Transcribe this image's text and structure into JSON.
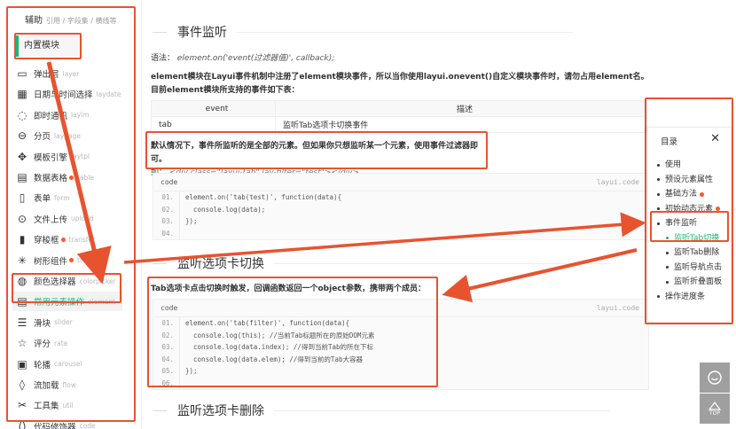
{
  "sidebar": {
    "head_title": "辅助",
    "head_sub": "引用 / 字段集 / 横线等",
    "group_label": "内置模块",
    "items": [
      {
        "icon": "layer-icon",
        "glyph": "▭",
        "label": "弹出层",
        "en": "layer",
        "dot": false
      },
      {
        "icon": "calendar-icon",
        "glyph": "▦",
        "label": "日期与时间选择",
        "en": "laydate",
        "dot": false
      },
      {
        "icon": "chat-icon",
        "glyph": "◌",
        "label": "即时通讯",
        "en": "layim",
        "dot": false
      },
      {
        "icon": "page-icon",
        "glyph": "⊖",
        "label": "分页",
        "en": "laypage",
        "dot": false
      },
      {
        "icon": "template-icon",
        "glyph": "✥",
        "label": "模板引擎",
        "en": "laytpl",
        "dot": false
      },
      {
        "icon": "table-icon",
        "glyph": "▤",
        "label": "数据表格",
        "en": "table",
        "dot": true
      },
      {
        "icon": "form-icon",
        "glyph": "▯",
        "label": "表单",
        "en": "form",
        "dot": false
      },
      {
        "icon": "upload-icon",
        "glyph": "⊙",
        "label": "文件上传",
        "en": "upload",
        "dot": false
      },
      {
        "icon": "transfer-icon",
        "glyph": "▮",
        "label": "穿梭框",
        "en": "transfer",
        "dot": true
      },
      {
        "icon": "tree-icon",
        "glyph": "✳",
        "label": "树形组件",
        "en": "tree",
        "dot": true
      },
      {
        "icon": "palette-icon",
        "glyph": "◍",
        "label": "颜色选择器",
        "en": "colorpicker",
        "dot": false
      },
      {
        "icon": "element-icon",
        "glyph": "▤",
        "label": "常用元素操作",
        "en": "element",
        "dot": false
      },
      {
        "icon": "slider-icon",
        "glyph": "☰",
        "label": "滑块",
        "en": "slider",
        "dot": false
      },
      {
        "icon": "star-icon",
        "glyph": "☆",
        "label": "评分",
        "en": "rate",
        "dot": false
      },
      {
        "icon": "carousel-icon",
        "glyph": "▣",
        "label": "轮播",
        "en": "carousel",
        "dot": false
      },
      {
        "icon": "flow-icon",
        "glyph": "◊",
        "label": "流加载",
        "en": "flow",
        "dot": false
      },
      {
        "icon": "tools-icon",
        "glyph": "✂",
        "label": "工具集",
        "en": "util",
        "dot": false
      },
      {
        "icon": "code-icon",
        "glyph": "⟨⟩",
        "label": "代码修饰器",
        "en": "code",
        "dot": false
      }
    ],
    "active_index": 11
  },
  "main": {
    "section1_title": "事件监听",
    "syntax_label": "语法：",
    "syntax_code": "element.on('event(过滤器值)', callback);",
    "paragraph": "element模块在Layui事件机制中注册了element模块事件，所以当你使用layui.onevent()自定义模块事件时，请勿占用element名。目前element模块所支持的事件如下表：",
    "table_headers": [
      "event",
      "描述"
    ],
    "table_rows": [
      [
        "tab",
        "监听Tab选项卡切换事件"
      ]
    ],
    "note_line1": "默认情况下，事件所监听的是全部的元素。但如果你只想监听某一个元素，使用事件过滤器即可。",
    "note_prefix": "如：",
    "note_code": "<div class=\"layui-tab\" lay-filter=\"test\"></div>",
    "code1": {
      "label": "code",
      "right": "layui.code",
      "lines": [
        {
          "n": "01.",
          "t": "element.on('tab(test)', function(data){"
        },
        {
          "n": "02.",
          "t": "  console.log(data);"
        },
        {
          "n": "03.",
          "t": "});"
        },
        {
          "n": "04.",
          "t": ""
        }
      ]
    },
    "section2_title": "监听选项卡切换",
    "paragraph2": "Tab选项卡点击切换时触发，回调函数返回一个object参数，携带两个成员：",
    "code2": {
      "label": "code",
      "right": "layui.code",
      "lines": [
        {
          "n": "01.",
          "t": "element.on('tab(filter)', function(data){"
        },
        {
          "n": "02.",
          "t": "  console.log(this); //当前Tab标题所在的原始DOM元素"
        },
        {
          "n": "03.",
          "t": "  console.log(data.index); //得到当前Tab的所在下标"
        },
        {
          "n": "04.",
          "t": "  console.log(data.elem); //得到当前的Tab大容器"
        },
        {
          "n": "05.",
          "t": "});"
        },
        {
          "n": "06.",
          "t": ""
        }
      ]
    },
    "section3_title": "监听选项卡删除"
  },
  "toc": {
    "title": "目录",
    "close": "✕",
    "items": [
      {
        "label": "使用",
        "sub": false,
        "dot": false,
        "current": false
      },
      {
        "label": "预设元素属性",
        "sub": false,
        "dot": false,
        "current": false
      },
      {
        "label": "基础方法",
        "sub": false,
        "dot": true,
        "current": false
      },
      {
        "label": "初始动态元素",
        "sub": false,
        "dot": true,
        "current": false
      },
      {
        "label": "事件监听",
        "sub": false,
        "dot": false,
        "current": false
      },
      {
        "label": "监听Tab切换",
        "sub": true,
        "dot": false,
        "current": true
      },
      {
        "label": "监听Tab删除",
        "sub": true,
        "dot": false,
        "current": false
      },
      {
        "label": "监听导航点击",
        "sub": true,
        "dot": false,
        "current": false
      },
      {
        "label": "监听折叠面板",
        "sub": true,
        "dot": false,
        "current": false
      },
      {
        "label": "操作进度条",
        "sub": false,
        "dot": false,
        "current": false
      }
    ]
  },
  "float_buttons": {
    "chat_icon": "chat-bubble-icon",
    "top_label": "TOP"
  },
  "colors": {
    "accent": "#16b777",
    "annotation_red": "#e8532f",
    "badge_dot": "#ff5722"
  }
}
